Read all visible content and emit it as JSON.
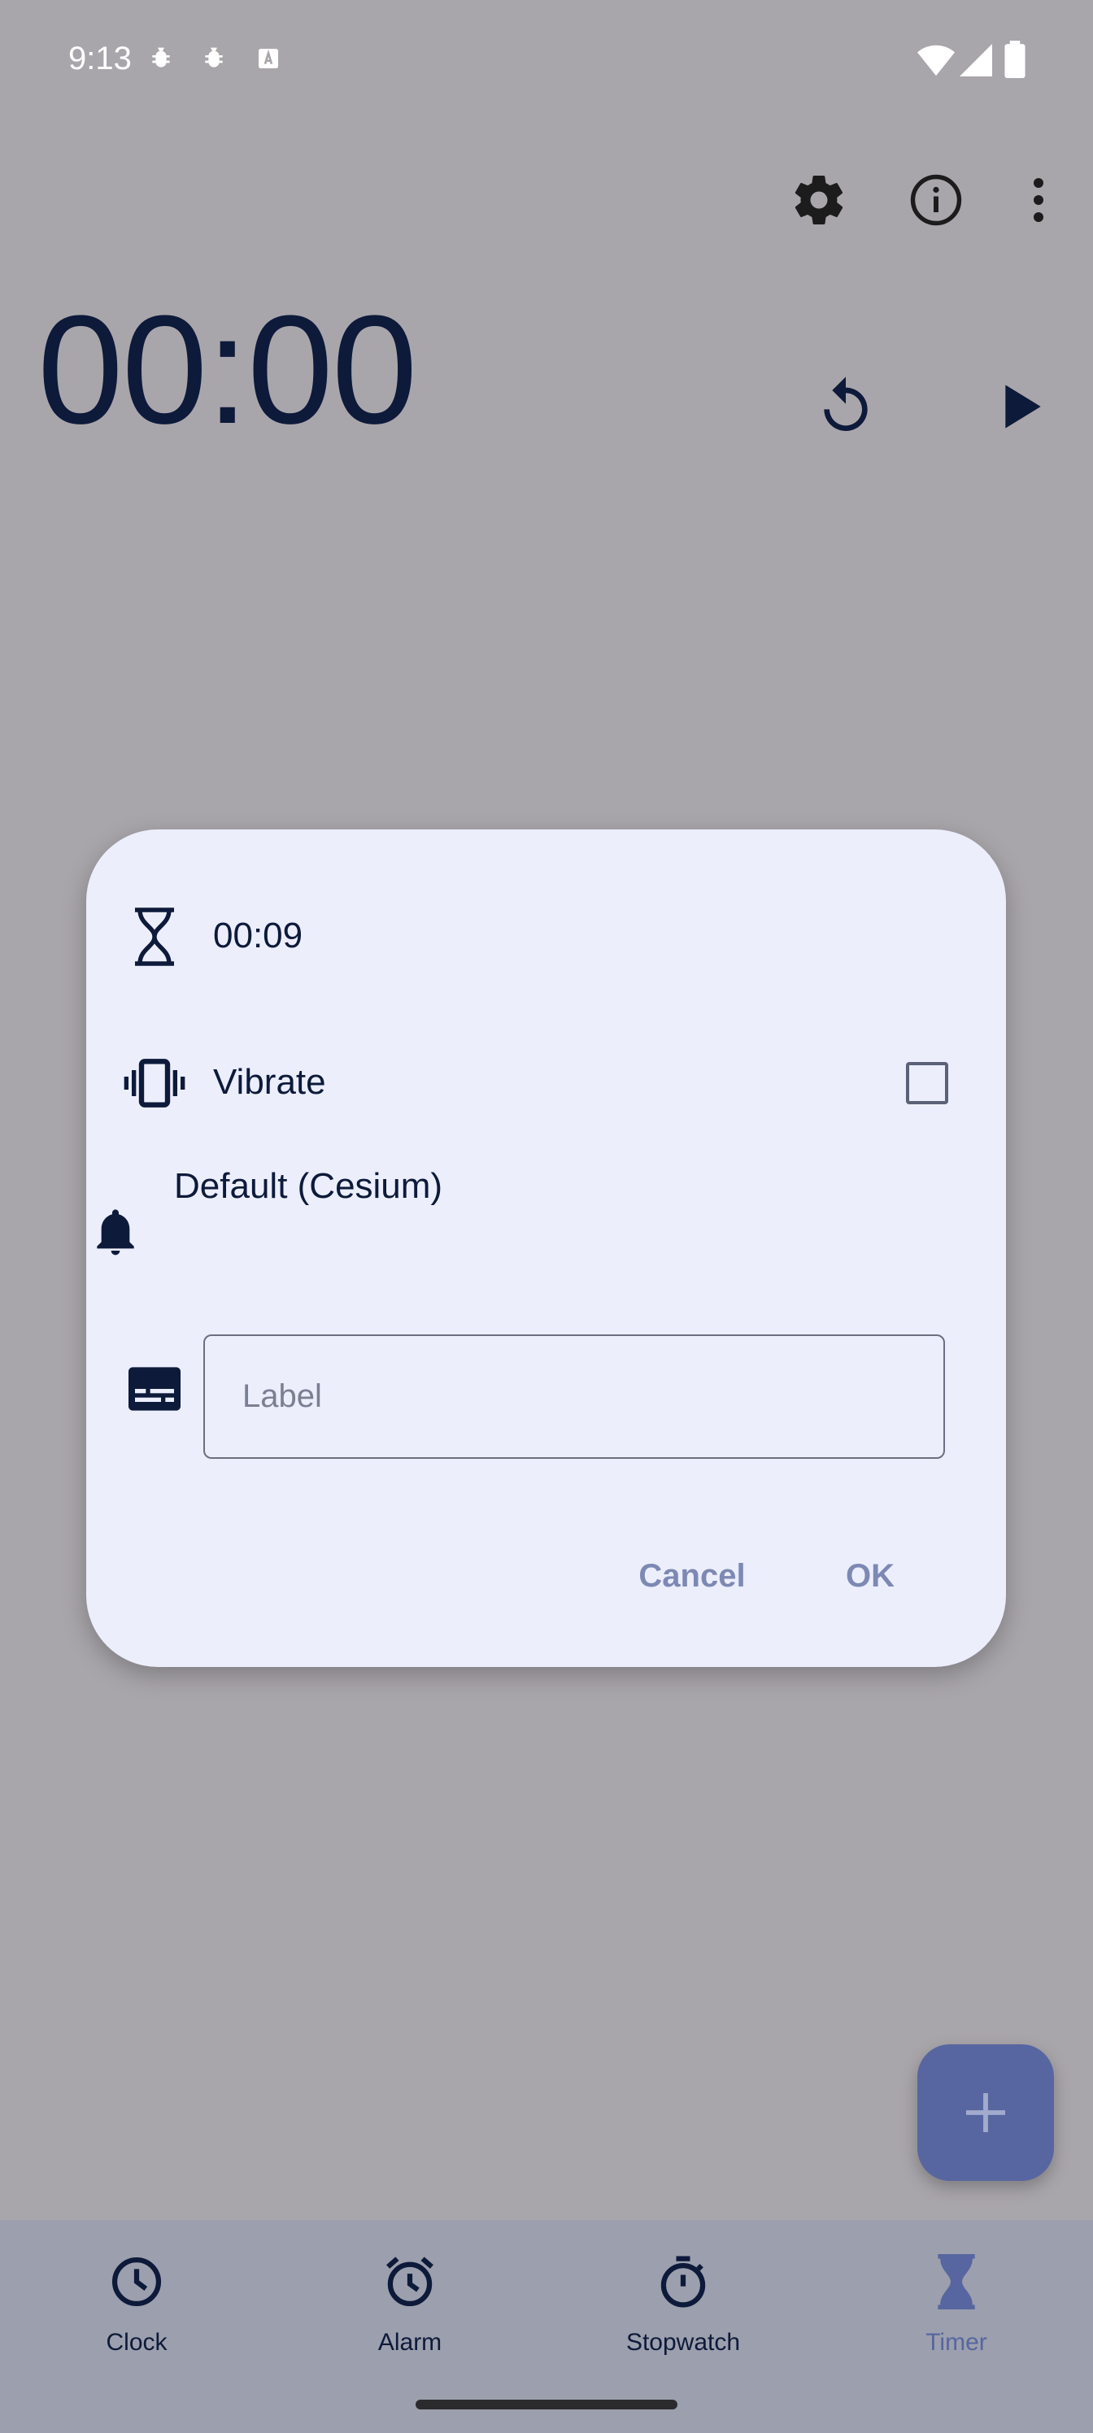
{
  "status_bar": {
    "time": "9:13",
    "icons": [
      "bug-icon",
      "bug-icon",
      "keyboard-a-icon",
      "wifi-icon",
      "signal-icon",
      "battery-icon"
    ]
  },
  "toolbar": {
    "icons": [
      "gear-icon",
      "info-icon",
      "more-vert-icon"
    ]
  },
  "timer": {
    "display": "00:00",
    "controls": [
      "reset-icon",
      "play-icon"
    ]
  },
  "dialog": {
    "duration": "00:09",
    "vibrate_label": "Vibrate",
    "vibrate_checked": false,
    "ringtone": "Default (Cesium)",
    "label_placeholder": "Label",
    "label_value": "",
    "cancel_label": "Cancel",
    "ok_label": "OK"
  },
  "fab": {
    "icon": "plus-icon"
  },
  "bottom_nav": {
    "items": [
      {
        "label": "Clock",
        "icon": "clock-icon",
        "selected": false
      },
      {
        "label": "Alarm",
        "icon": "alarm-icon",
        "selected": false
      },
      {
        "label": "Stopwatch",
        "icon": "stopwatch-icon",
        "selected": false
      },
      {
        "label": "Timer",
        "icon": "hourglass-icon",
        "selected": true
      }
    ]
  },
  "colors": {
    "scrim": "#a9a6ab",
    "dialog_bg": "#eceefc",
    "text_primary": "#0d1a3a",
    "button_text": "#7d89b3",
    "fab_bg": "#5766a0",
    "nav_bg": "#9c9fad",
    "nav_selected": "#5766a0"
  }
}
